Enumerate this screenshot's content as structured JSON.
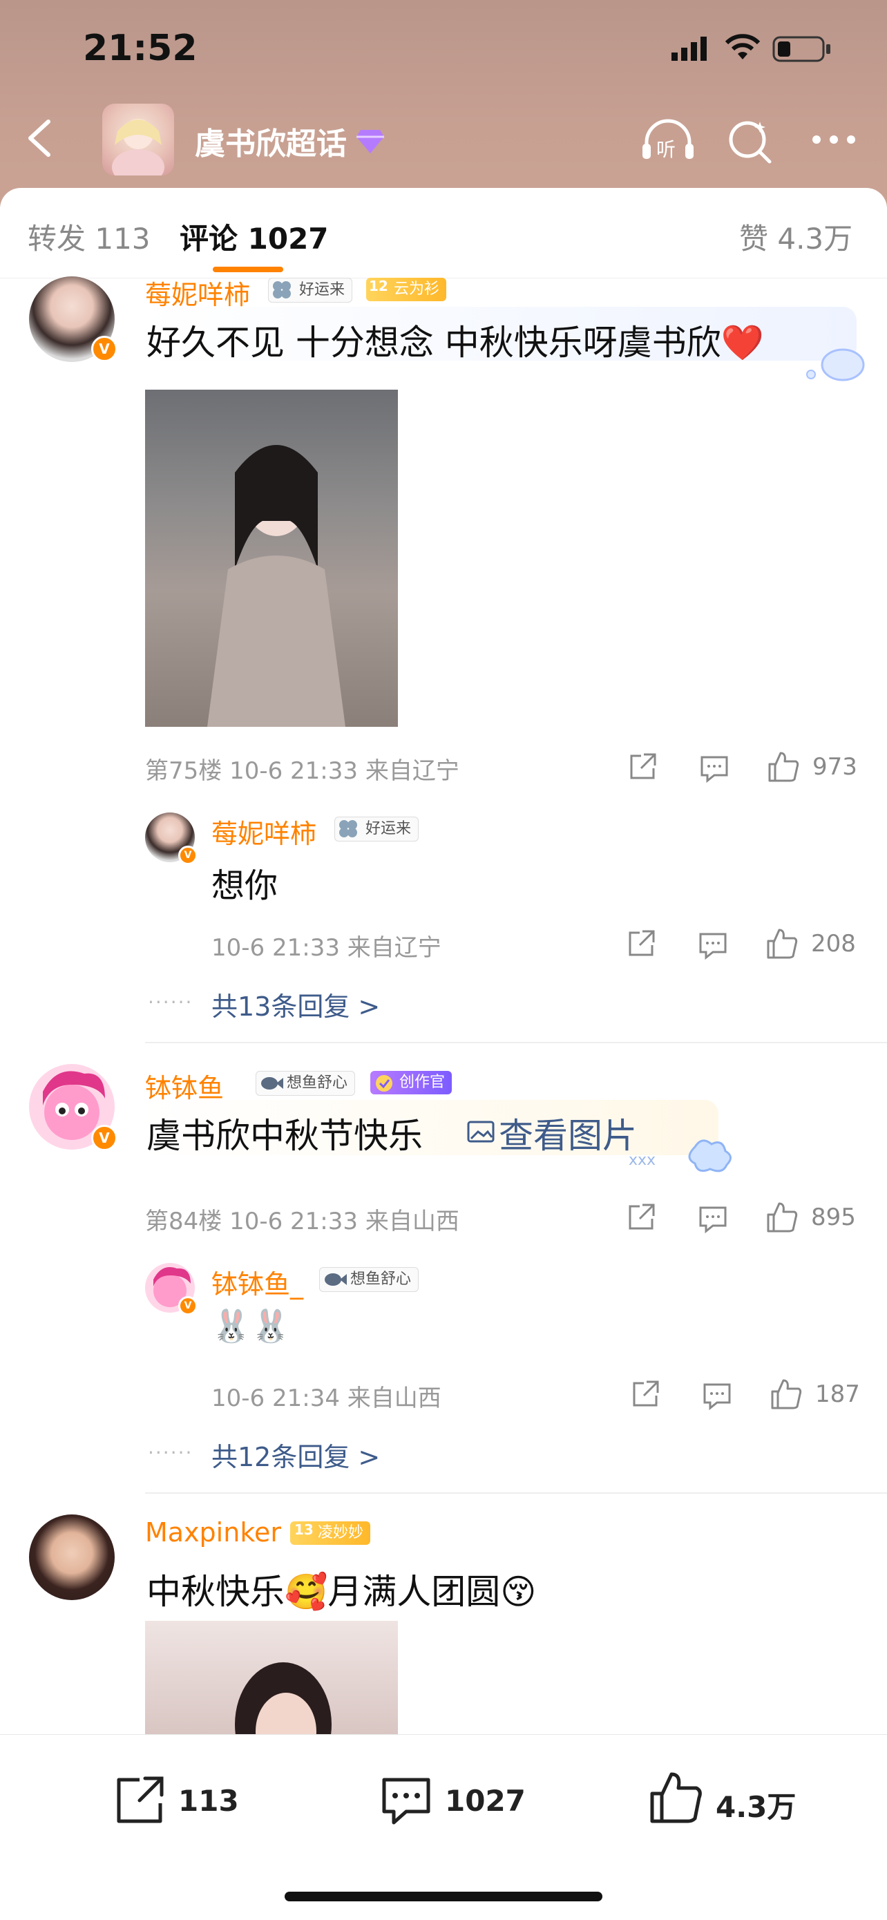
{
  "status_bar": {
    "time": "21:52"
  },
  "header": {
    "title": "虞书欣超话"
  },
  "tabs": {
    "repost": "转发 113",
    "comment": "评论 1027",
    "like": "赞 4.3万"
  },
  "comments": [
    {
      "username": "莓妮咩柿",
      "tags": [
        "好运来",
        "云为衫"
      ],
      "level": "12",
      "text": "好久不见 十分想念 中秋快乐呀虞书欣❤️",
      "meta": "第75楼 10-6 21:33 来自辽宁",
      "likes": "973",
      "reply": {
        "username": "莓妮咩柿",
        "tag": "好运来",
        "text": "想你",
        "meta": "10-6 21:33 来自辽宁",
        "likes": "208"
      },
      "reply_more": "共13条回复 >"
    },
    {
      "username": "钵钵鱼_",
      "tags": [
        "想鱼舒心",
        "创作官"
      ],
      "text": "虞书欣中秋节快乐",
      "view_image": "查看图片",
      "meta": "第84楼 10-6 21:33 来自山西",
      "likes": "895",
      "reply": {
        "username": "钵钵鱼_",
        "tag": "想鱼舒心",
        "text": "🐰🐰",
        "meta": "10-6 21:34 来自山西",
        "likes": "187"
      },
      "reply_more": "共12条回复 >"
    },
    {
      "username": "Maxpinker",
      "tags": [
        "凌妙妙"
      ],
      "level": "13",
      "text": "中秋快乐🥰月满人团圆😚"
    }
  ],
  "bottom_bar": {
    "repost": "113",
    "comment": "1027",
    "like": "4.3万"
  },
  "colors": {
    "accent": "#ff8200",
    "link": "#3e5b8a"
  }
}
